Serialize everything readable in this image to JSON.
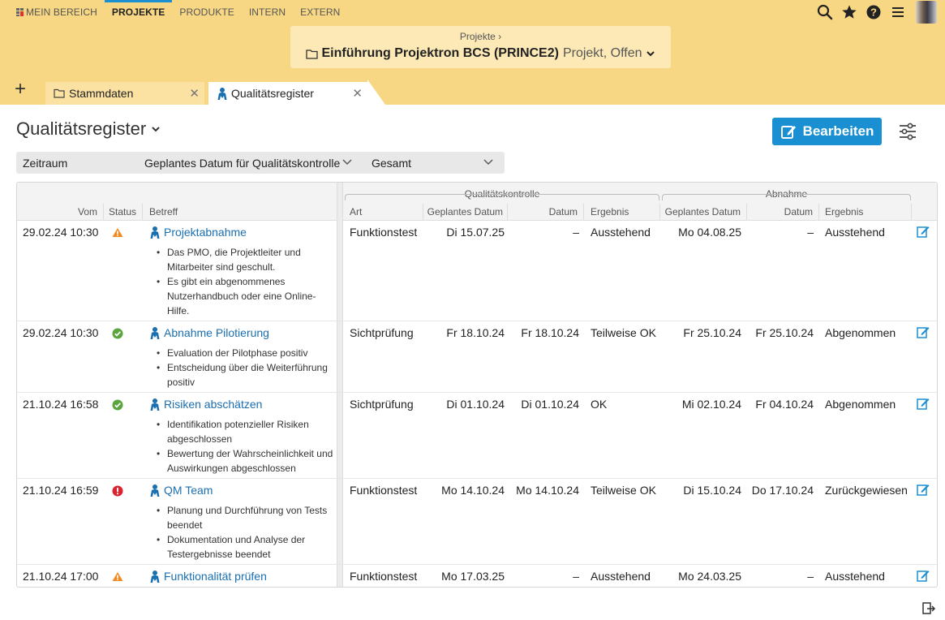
{
  "nav": {
    "items": [
      {
        "label": "MEIN BEREICH"
      },
      {
        "label": "PROJEKTE"
      },
      {
        "label": "PRODUKTE"
      },
      {
        "label": "INTERN"
      },
      {
        "label": "EXTERN"
      }
    ]
  },
  "icons": {
    "search": "search-icon",
    "favorite": "star-icon",
    "help": "help-icon",
    "menu": "hamburger-menu-icon",
    "avatar": "user-avatar"
  },
  "breadcrumb": {
    "parent": "Projekte ›",
    "title": "Einführung Projektron BCS (PRINCE2)",
    "subtitle": "Projekt, Offen"
  },
  "tabs": {
    "add": "+",
    "items": [
      {
        "label": "Stammdaten"
      },
      {
        "label": "Qualitätsregister"
      }
    ]
  },
  "page": {
    "title": "Qualitätsregister",
    "edit_button": "Bearbeiten"
  },
  "filter": {
    "label": "Zeitraum",
    "field": "Geplantes Datum für Qualitätskontrolle",
    "range": "Gesamt"
  },
  "colors": {
    "accent": "#1a8fd1",
    "header_bg": "#f7d784",
    "warning": "#f08a24",
    "ok": "#5aa63c",
    "error": "#d9232e"
  },
  "table": {
    "group_quality": "Qualitätskontrolle",
    "group_acceptance": "Abnahme",
    "columns": {
      "vom": "Vom",
      "status": "Status",
      "betreff": "Betreff",
      "art": "Art",
      "q_planned": "Geplantes Datum",
      "q_date": "Datum",
      "q_result": "Ergebnis",
      "a_planned": "Geplantes Datum",
      "a_date": "Datum",
      "a_result": "Ergebnis"
    },
    "rows": [
      {
        "vom": "29.02.24 10:30",
        "status": "warning",
        "betreff": "Projektabnahme",
        "bullets": [
          "Das PMO, die Projektleiter und Mitarbeiter sind geschult.",
          "Es gibt ein abgenommenes Nutzerhandbuch oder eine Online-Hilfe."
        ],
        "art": "Funktionstest",
        "q_planned": "Di 15.07.25",
        "q_date": "–",
        "q_result": "Ausstehend",
        "a_planned": "Mo 04.08.25",
        "a_date": "–",
        "a_result": "Ausstehend"
      },
      {
        "vom": "29.02.24 10:30",
        "status": "ok",
        "betreff": "Abnahme Pilotierung",
        "bullets": [
          "Evaluation der Pilotphase positiv",
          "Entscheidung über die Weiterführung positiv"
        ],
        "art": "Sichtprüfung",
        "q_planned": "Fr 18.10.24",
        "q_date": "Fr 18.10.24",
        "q_result": "Teilweise OK",
        "a_planned": "Fr 25.10.24",
        "a_date": "Fr 25.10.24",
        "a_result": "Abgenommen"
      },
      {
        "vom": "21.10.24 16:58",
        "status": "ok",
        "betreff": "Risiken abschätzen",
        "bullets": [
          "Identifikation potenzieller Risiken abgeschlossen",
          "Bewertung der Wahrscheinlichkeit und Auswirkungen abgeschlossen"
        ],
        "art": "Sichtprüfung",
        "q_planned": "Di 01.10.24",
        "q_date": "Di 01.10.24",
        "q_result": "OK",
        "a_planned": "Mi 02.10.24",
        "a_date": "Fr 04.10.24",
        "a_result": "Abgenommen"
      },
      {
        "vom": "21.10.24 16:59",
        "status": "error",
        "betreff": "QM Team",
        "bullets": [
          "Planung und Durchführung von Tests beendet",
          "Dokumentation und Analyse der Testergebnisse beendet"
        ],
        "art": "Funktionstest",
        "q_planned": "Mo 14.10.24",
        "q_date": "Mo 14.10.24",
        "q_result": "Teilweise OK",
        "a_planned": "Di 15.10.24",
        "a_date": "Do 17.10.24",
        "a_result": "Zurückgewiesen"
      },
      {
        "vom": "21.10.24 17:00",
        "status": "warning",
        "betreff": "Funktionalität prüfen",
        "bullets": [],
        "art": "Funktionstest",
        "q_planned": "Mo 17.03.25",
        "q_date": "–",
        "q_result": "Ausstehend",
        "a_planned": "Mo 24.03.25",
        "a_date": "–",
        "a_result": "Ausstehend"
      }
    ]
  }
}
